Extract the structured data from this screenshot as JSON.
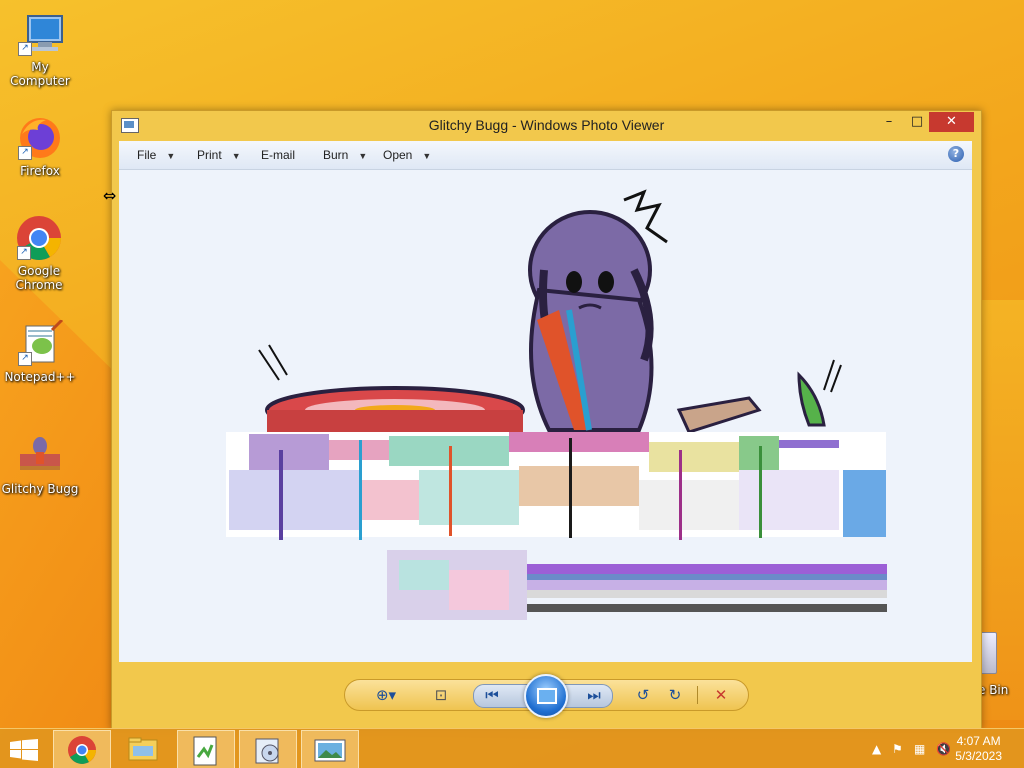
{
  "desktop": {
    "icons": [
      {
        "label": "My Computer",
        "icon": "computer-icon"
      },
      {
        "label": "Firefox",
        "icon": "firefox-icon"
      },
      {
        "label": "Google Chrome",
        "icon": "chrome-icon"
      },
      {
        "label": "Notepad++",
        "icon": "notepadpp-icon"
      },
      {
        "label": "Glitchy Bugg",
        "icon": "image-file-icon"
      }
    ],
    "recycle_bin_label": "e Bin"
  },
  "window": {
    "title": "Glitchy Bugg - Windows Photo Viewer",
    "buttons": {
      "minimize": "–",
      "maximize": "□",
      "close": "✕"
    }
  },
  "menubar": {
    "items": [
      "File",
      "Print",
      "E-mail",
      "Burn",
      "Open"
    ],
    "help": "?"
  },
  "controls": {
    "zoom": "⊕▾",
    "actual_size": "⊡",
    "previous": "⏮",
    "next": "⏭",
    "rotate_left": "↺",
    "rotate_right": "↻",
    "delete": "✕"
  },
  "taskbar": {
    "apps": [
      "chrome-icon",
      "file-explorer-icon",
      "notepadpp-icon",
      "media-icon",
      "photo-viewer-icon"
    ],
    "clock_time": "4:07 AM",
    "clock_date": "5/3/2023"
  },
  "colors": {
    "wallpaper": "#f3a61c",
    "window_frame": "#f2c84c",
    "close_button": "#c7392f",
    "canvas": "#eef3fb"
  }
}
